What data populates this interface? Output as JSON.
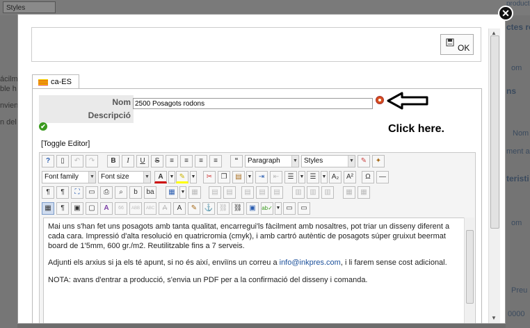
{
  "background": {
    "styles_select": "Styles",
    "right_texts": [
      "producto bus",
      "ctes re",
      "om",
      "ns",
      "Nom",
      "ment a",
      "teristi",
      "om",
      "Preu",
      "0000"
    ],
    "left_texts": [
      "ácilment",
      "ble h",
      "nvien",
      "n del"
    ]
  },
  "modal": {
    "ok_button": "OK",
    "language_tab": "ca-ES",
    "fields": {
      "nom_label": "Nom",
      "nom_value": "2500 Posagots rodons",
      "descripcio_label": "Descripció"
    },
    "annotation": "Click here.",
    "toggle_editor": "[Toggle Editor]",
    "toolbar": {
      "paragraph_select": "Paragraph",
      "styles_select": "Styles",
      "font_family_select": "Font family",
      "font_size_select": "Font size"
    },
    "content": {
      "p1": "Mai uns s'han fet uns posagots amb tanta qualitat, encarregui'ls fàcilment amb nosaltres, pot triar un disseny diferent a cada cara. Impressió d'alta resolució en quatricromia (cmyk), i amb cartró autèntic de posagots súper gruixut beermat board de 1'5mm, 600 gr./m2. Reutilitzable fins a 7 serveis.",
      "p2_before": "Adjunti els arxius si ja els té apunt, si no és així, enviïns un correu a ",
      "p2_link": "info@inkpres.com",
      "p2_after": ", i li farem sense cost adicional.",
      "p3": "NOTA: avans d'entrar a producció, s'envia un PDF per a la confirmació del disseny i comanda."
    }
  },
  "colors": {
    "required_icon": "#d64e1c",
    "link": "#1a4f9a",
    "check_icon": "#3a9a1e"
  }
}
